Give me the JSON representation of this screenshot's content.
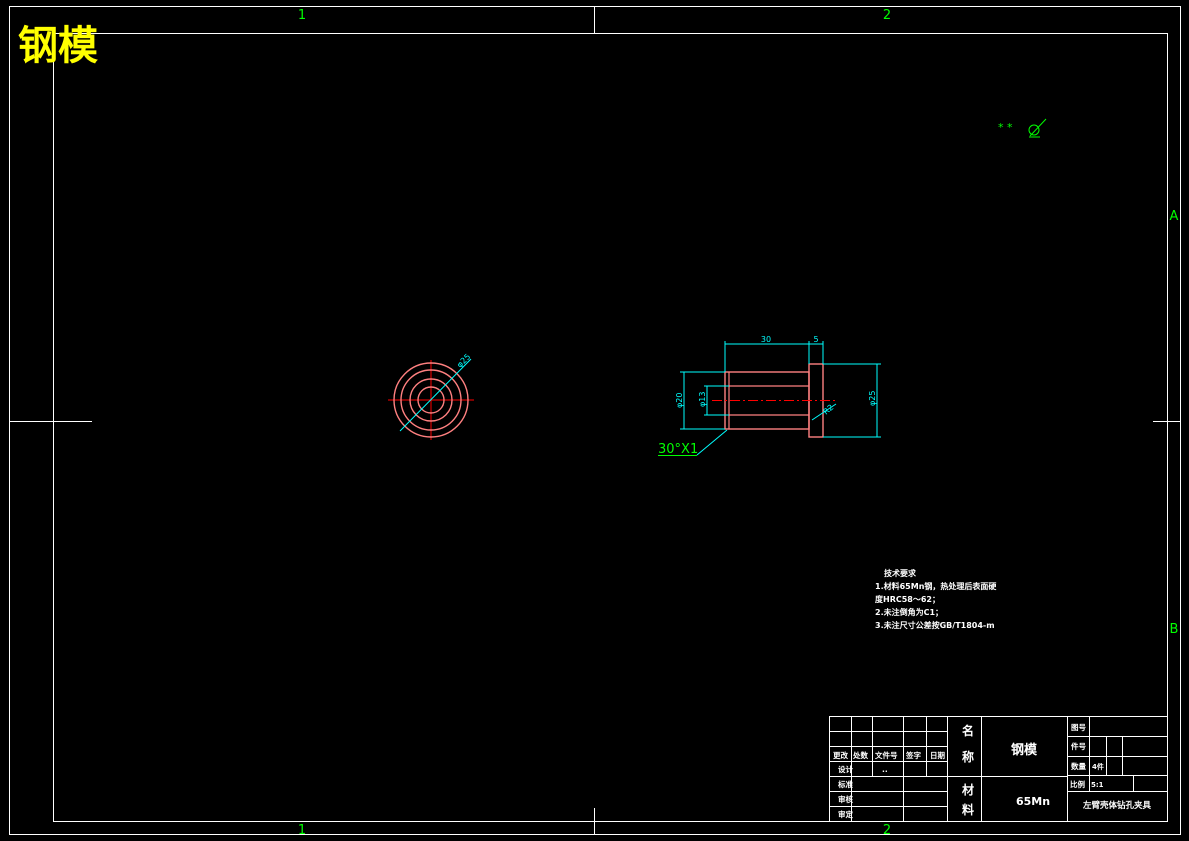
{
  "drawing": {
    "title": "钢模",
    "zone_columns": [
      "1",
      "2"
    ],
    "zone_rows": [
      "A",
      "B"
    ]
  },
  "surface_symbol": {
    "marks": "* *"
  },
  "views": {
    "end_view": {
      "dimension": "φ25"
    },
    "side_view": {
      "dim_length": "30",
      "dim_flange": "5",
      "dim_outer": "φ20",
      "dim_bore": "φ13",
      "dim_flange_dia": "φ25",
      "dim_radius": "R2",
      "chamfer_note": "30°X1"
    }
  },
  "technical_requirements": {
    "heading": "技术要求",
    "lines": [
      "1.材料65Mn钢，热处理后表面硬",
      "度HRC58～62；",
      "2.未注倒角为C1；",
      "3.未注尺寸公差按GB/T1804-m"
    ]
  },
  "title_block": {
    "headers": [
      "更改",
      "处数",
      "文件号",
      "签字",
      "日期"
    ],
    "roles": [
      "设计",
      "标准",
      "审核",
      "审定"
    ],
    "designer_value": "..",
    "name_label": [
      "名",
      "称"
    ],
    "name_value": "钢模",
    "material_label": [
      "材",
      "料"
    ],
    "material_value": "65Mn",
    "drawing_no_label": "图号",
    "part_no_label": "件号",
    "quantity_label": "数量",
    "quantity_value": "4件",
    "scale_label": "比例",
    "scale_value": "5:1",
    "assembly_name": "左臂壳体钻孔夹具"
  },
  "colors": {
    "frame": "#ffffff",
    "zone": "#00ff00",
    "title": "#ffff00",
    "dimension": "#00ffff",
    "part": "#ff7f7f",
    "centerline": "#ff0000",
    "annotation": "#00ff00"
  }
}
